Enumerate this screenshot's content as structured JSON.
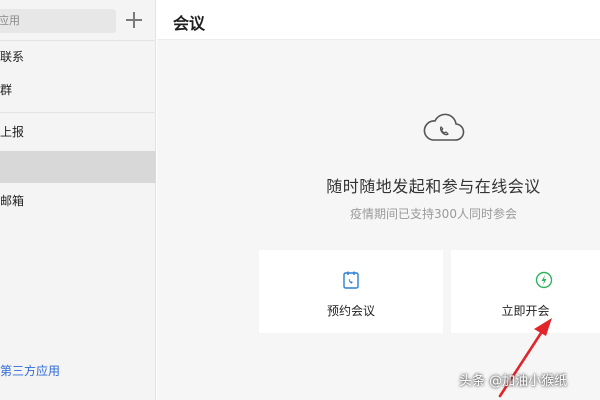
{
  "sidebar": {
    "search_placeholder": "应用",
    "items": [
      {
        "label": "联系"
      },
      {
        "label": "群"
      },
      {
        "label": "上报"
      },
      {
        "label": ""
      },
      {
        "label": "邮箱"
      }
    ],
    "third_party_link": "第三方应用"
  },
  "main": {
    "title": "会议",
    "empty_state": {
      "icon": "cloud-phone-icon",
      "headline": "随时随地发起和参与在线会议",
      "subline": "疫情期间已支持300人同时参会"
    },
    "actions": [
      {
        "label": "预约会议",
        "icon": "calendar-phone-icon",
        "icon_color": "#2b7fd6"
      },
      {
        "label": "立即开会",
        "icon": "lightning-icon",
        "icon_color": "#2fb35f"
      }
    ]
  },
  "annotation": {
    "arrow_color": "#e0252b"
  },
  "watermark": "头条 @加油小猴纸"
}
